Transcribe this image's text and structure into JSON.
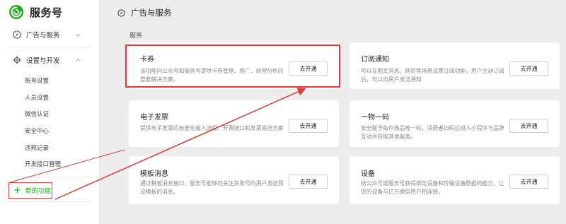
{
  "app": {
    "name": "服务号"
  },
  "sidebar": {
    "groups": [
      {
        "label": "广告与服务",
        "icon": "compass-icon",
        "expanded": false
      },
      {
        "label": "设置与开发",
        "icon": "gear-icon",
        "expanded": true
      }
    ],
    "sub_items": [
      {
        "label": "账号设置"
      },
      {
        "label": "人员设置"
      },
      {
        "label": "微信认证"
      },
      {
        "label": "安全中心"
      },
      {
        "label": "违规记录"
      },
      {
        "label": "开发接口管理"
      }
    ],
    "new_feature": {
      "label": "新的功能",
      "icon": "plus-icon"
    }
  },
  "header": {
    "title": "广告与服务",
    "icon": "compass-icon"
  },
  "main": {
    "section_title": "服务",
    "cards": [
      {
        "title": "卡券",
        "desc": "该功能向公众号和服务号提供卡券管理、推广、经营分析的整套解决方案。",
        "button": "去开通"
      },
      {
        "title": "订阅通知",
        "desc": "可以在图文消息、网页等场景设置订阅功能，用户主动订阅后，可以向用户发送通知",
        "button": "去开通"
      },
      {
        "title": "电子发票",
        "desc": "提供电子发票的标准化接入流程、开票接口和发票递送方案",
        "button": "去开通"
      },
      {
        "title": "一物一码",
        "desc": "安全赋予每件商品唯一码，消费者扫码后进入小程序与品牌互动并获取其他服务。",
        "button": "去开通"
      },
      {
        "title": "模板消息",
        "desc": "通过模板消息接口，服务号能够向关注其账号的用户发送预设模板的消息。",
        "button": "去开通"
      },
      {
        "title": "设备",
        "desc": "给公众号或服务号获得绑定设备和传输设备数据的能力，让您的设备与亿万微信用户相连接。",
        "button": "去开通"
      }
    ]
  },
  "colors": {
    "accent": "#1aad19",
    "annotation": "#e53935",
    "background": "#ededed"
  }
}
